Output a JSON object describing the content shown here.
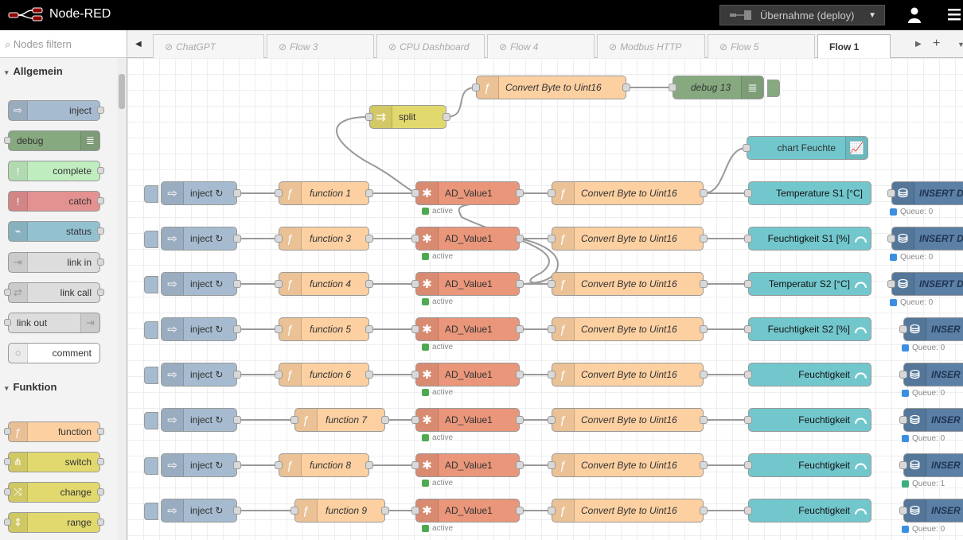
{
  "header": {
    "title": "Node-RED",
    "deploy_label": "Übernahme (deploy)"
  },
  "palette": {
    "search_placeholder": "Nodes filtern",
    "categories": [
      {
        "label": "Allgemein",
        "items": [
          {
            "label": "inject",
            "color": "#a6bbcf",
            "icon": "arrow-right-icon"
          },
          {
            "label": "debug",
            "color": "#87a980",
            "icon": "list-icon"
          },
          {
            "label": "complete",
            "color": "#c0edc0",
            "icon": "exclamation-icon"
          },
          {
            "label": "catch",
            "color": "#e49191",
            "icon": "exclamation-icon"
          },
          {
            "label": "status",
            "color": "#94c1d0",
            "icon": "pulse-icon"
          },
          {
            "label": "link in",
            "color": "#dddddd",
            "icon": "link-in-icon"
          },
          {
            "label": "link call",
            "color": "#dddddd",
            "icon": "link-call-icon"
          },
          {
            "label": "link out",
            "color": "#dddddd",
            "icon": "link-out-icon"
          },
          {
            "label": "comment",
            "color": "#ffffff",
            "icon": "comment-icon"
          }
        ]
      },
      {
        "label": "Funktion",
        "items": [
          {
            "label": "function",
            "color": "#fdd0a2",
            "icon": "function-icon"
          },
          {
            "label": "switch",
            "color": "#e2d96e",
            "icon": "switch-icon"
          },
          {
            "label": "change",
            "color": "#e2d96e",
            "icon": "shuffle-icon"
          },
          {
            "label": "range",
            "color": "#e2d96e",
            "icon": "range-icon"
          }
        ]
      }
    ]
  },
  "tabs": [
    {
      "label": "ChatGPT",
      "active": false
    },
    {
      "label": "Flow 3",
      "active": false
    },
    {
      "label": "CPU Dashboard",
      "active": false
    },
    {
      "label": "Flow 4",
      "active": false
    },
    {
      "label": "Modbus HTTP",
      "active": false
    },
    {
      "label": "Flow 5",
      "active": false
    },
    {
      "label": "Flow 1",
      "active": true
    }
  ],
  "colors": {
    "inject": "#a6bbcf",
    "function": "#fdd0a2",
    "modbus": "#e9967a",
    "split": "#e2d96e",
    "debug": "#87a980",
    "dashboard": "#72c7cd",
    "db": "#5b7fa5",
    "status_active": "#4ea950",
    "status_queue": "#3b8fe0",
    "status_queue_one": "#3cae7a"
  },
  "flow": {
    "top_nodes": {
      "split": "split",
      "convert": "Convert Byte to Uint16",
      "debug": "debug 13",
      "chart": "chart Feuchte"
    },
    "rows": [
      {
        "inject": "inject ↻",
        "function": "function 1",
        "modbus": "AD_Value1",
        "modbus_status": "active",
        "convert": "Convert Byte to Uint16",
        "dash": "Temperature S1 [°C]",
        "dash_gauge": false,
        "db": "INSERT D",
        "queue": "Queue: 0"
      },
      {
        "inject": "inject ↻",
        "function": "function 3",
        "modbus": "AD_Value1",
        "modbus_status": "active",
        "convert": "Convert Byte to Uint16",
        "dash": "Feuchtigkeit S1 [%]",
        "dash_gauge": true,
        "db": "INSERT D",
        "queue": "Queue: 0"
      },
      {
        "inject": "inject ↻",
        "function": "function 4",
        "modbus": "AD_Value1",
        "modbus_status": "active",
        "convert": "Convert Byte to Uint16",
        "dash": "Temperatur S2 [°C]",
        "dash_gauge": true,
        "db": "INSERT D",
        "queue": "Queue: 0"
      },
      {
        "inject": "inject ↻",
        "function": "function 5",
        "modbus": "AD_Value1",
        "modbus_status": "active",
        "convert": "Convert Byte to Uint16",
        "dash": "Feuchtigkeit S2 [%]",
        "dash_gauge": true,
        "db": "INSER",
        "queue": "Queue: 0"
      },
      {
        "inject": "inject ↻",
        "function": "function 6",
        "modbus": "AD_Value1",
        "modbus_status": "active",
        "convert": "Convert Byte to Uint16",
        "dash": "Feuchtigkeit",
        "dash_gauge": true,
        "db": "INSER",
        "queue": "Queue: 0"
      },
      {
        "inject": "inject ↻",
        "function": "function 7",
        "modbus": "AD_Value1",
        "modbus_status": "active",
        "convert": "Convert Byte to Uint16",
        "dash": "Feuchtigkeit",
        "dash_gauge": true,
        "db": "INSER",
        "queue": "Queue: 0"
      },
      {
        "inject": "inject ↻",
        "function": "function 8",
        "modbus": "AD_Value1",
        "modbus_status": "active",
        "convert": "Convert Byte to Uint16",
        "dash": "Feuchtigkeit",
        "dash_gauge": true,
        "db": "INSER",
        "queue": "Queue: 1"
      },
      {
        "inject": "inject ↻",
        "function": "function 9",
        "modbus": "AD_Value1",
        "modbus_status": "active",
        "convert": "Convert Byte to Uint16",
        "dash": "Feuchtigkeit",
        "dash_gauge": true,
        "db": "INSER",
        "queue": "Queue: 0"
      }
    ]
  }
}
